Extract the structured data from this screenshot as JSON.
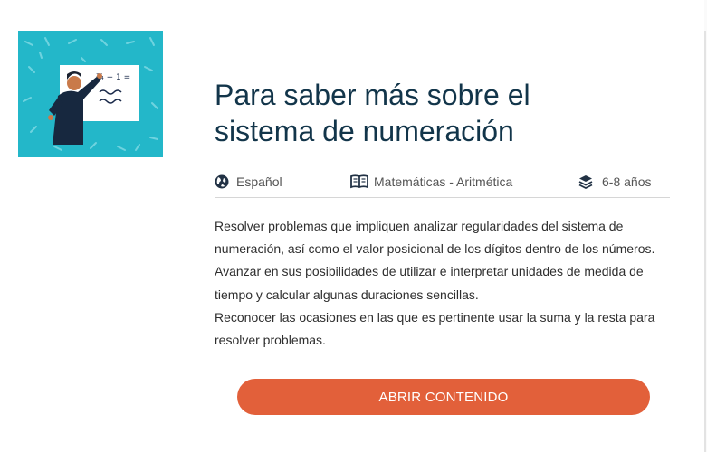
{
  "resource": {
    "title": "Para saber más sobre el sistema de numeración",
    "thumbnail": {
      "board_text": "¾ + 1 ="
    },
    "meta": {
      "language": {
        "icon": "globe-icon",
        "label": "Español"
      },
      "subject": {
        "icon": "book-icon",
        "label": "Matemáticas - Aritmética"
      },
      "age": {
        "icon": "layers-icon",
        "label": "6-8 años"
      }
    },
    "description": [
      "Resolver problemas que impliquen analizar regularidades del sistema de numeración, así como el valor posicional de los dígitos dentro de los números.",
      "Avanzar en sus posibilidades de utilizar e interpretar unidades de medida de tiempo y calcular algunas duraciones sencillas.",
      "Reconocer las ocasiones en las que es pertinente usar la suma y la resta para resolver problemas."
    ],
    "cta_label": "ABRIR CONTENIDO"
  },
  "colors": {
    "accent": "#e2603a",
    "title": "#12354a",
    "thumbnail_bg": "#23b7c9"
  }
}
